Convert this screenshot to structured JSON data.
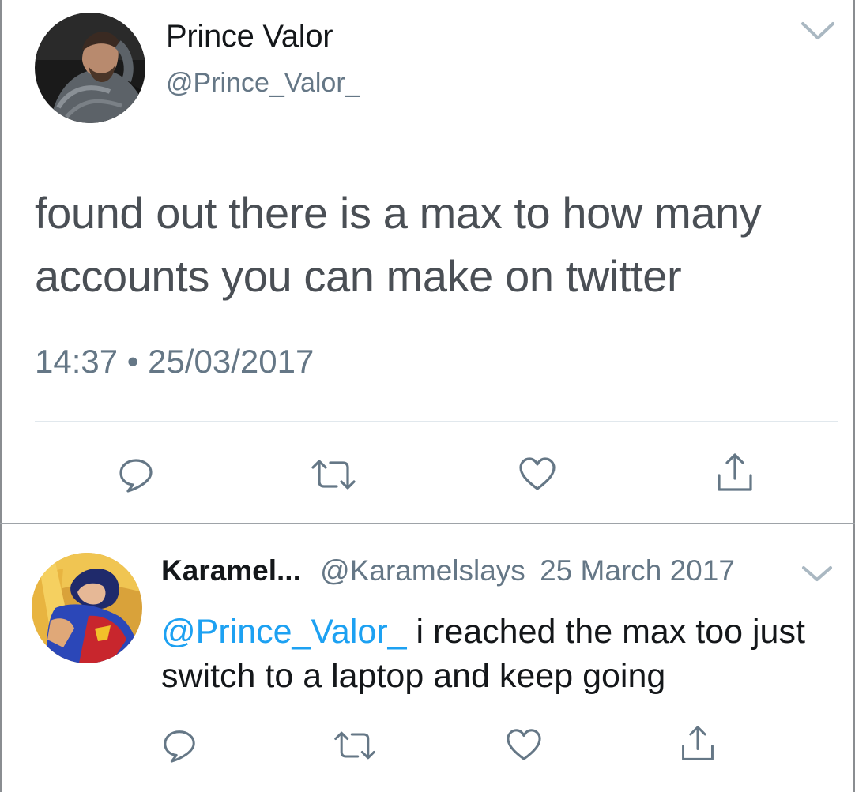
{
  "tweet": {
    "author_name": "Prince Valor",
    "author_handle": "@Prince_Valor_",
    "text": "found out there is a max to how many accounts you can make on twitter",
    "timestamp": "14:37 • 25/03/2017",
    "icons": {
      "caret": "chevron-down-icon",
      "reply": "reply-icon",
      "retweet": "retweet-icon",
      "like": "heart-icon",
      "share": "share-icon"
    }
  },
  "reply": {
    "author_name": "Karamel...",
    "author_handle": "@Karamelslays",
    "date": "25 March 2017",
    "mention": "@Prince_Valor_",
    "text": "i reached the max too just switch to a laptop and keep going"
  },
  "colors": {
    "link_blue": "#1da1f2",
    "secondary_gray": "#657786",
    "text_dark": "#14171a",
    "divider": "#e1e8ed"
  }
}
